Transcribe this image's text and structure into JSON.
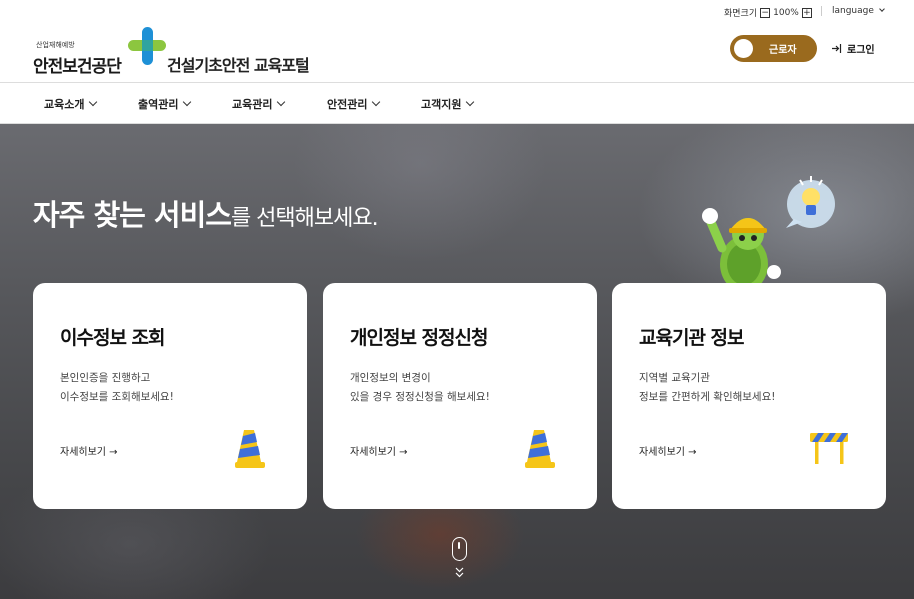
{
  "utility": {
    "zoom_label": "화면크기",
    "zoom_minus": "−",
    "zoom_value": "100%",
    "zoom_plus": "+",
    "language": "language"
  },
  "header": {
    "logo_small": "산업재해예방",
    "logo_main": "안전보건공단",
    "portal_title": "건설기초안전 교육포털",
    "worker_toggle": "근로자",
    "login": "로그인"
  },
  "nav": {
    "items": [
      "교육소개",
      "출역관리",
      "교육관리",
      "안전관리",
      "고객지원"
    ]
  },
  "hero": {
    "title_bold": "자주 찾는 서비스",
    "title_rest": "를 선택해보세요."
  },
  "cards": [
    {
      "title": "이수정보 조회",
      "desc1": "본인인증을 진행하고",
      "desc2": "이수정보를 조회해보세요!",
      "more": "자세히보기 →",
      "icon": "traffic-cone-icon"
    },
    {
      "title": "개인정보 정정신청",
      "desc1": "개인정보의 변경이",
      "desc2": "있을 경우 정정신청을 해보세요!",
      "more": "자세히보기 →",
      "icon": "traffic-cone-icon"
    },
    {
      "title": "교육기관 정보",
      "desc1": "지역별 교육기관",
      "desc2": "정보를 간편하게 확인해보세요!",
      "more": "자세히보기 →",
      "icon": "road-barrier-icon"
    }
  ],
  "colors": {
    "toggle_bg": "#9a6a1e",
    "logo_green": "#8cc63f",
    "logo_blue": "#1e90d6",
    "cone_yellow": "#f5c518",
    "cone_blue": "#3f6fd8"
  }
}
